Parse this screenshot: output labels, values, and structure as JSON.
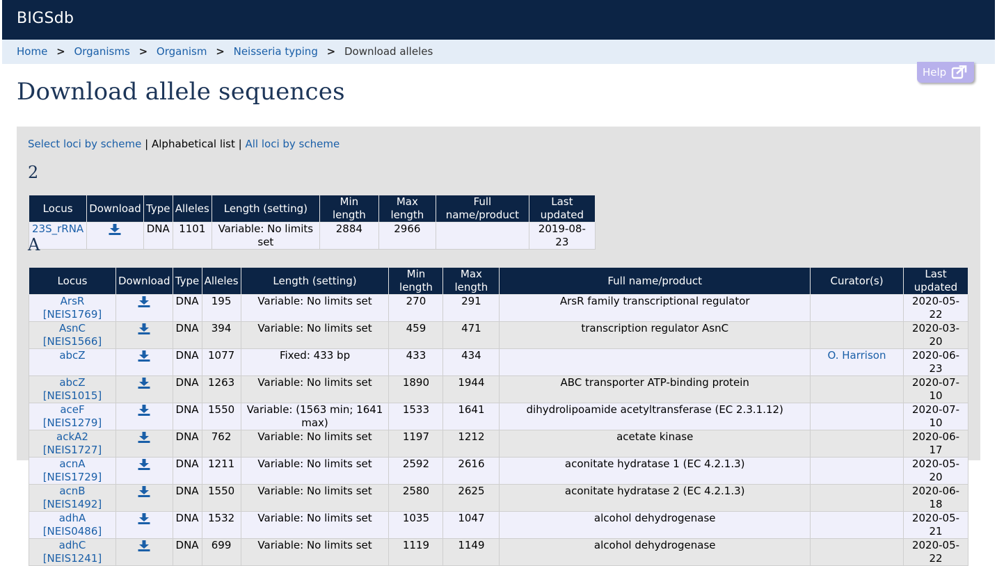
{
  "app": {
    "brand": "BIGSdb"
  },
  "breadcrumb": {
    "items": [
      {
        "label": "Home"
      },
      {
        "label": "Organisms"
      },
      {
        "label": "Organism"
      },
      {
        "label": "Neisseria typing"
      }
    ],
    "separator": ">",
    "current": "Download alleles"
  },
  "help": {
    "label": "Help",
    "icon": "external-link-icon"
  },
  "page": {
    "title": "Download allele sequences"
  },
  "tabs": {
    "select_by_scheme": "Select loci by scheme",
    "divider": "|",
    "alphabetical": "Alphabetical list",
    "all_by_scheme": "All loci by scheme"
  },
  "sections": [
    {
      "letter": "2",
      "headers": [
        "Locus",
        "Download",
        "Type",
        "Alleles",
        "Length (setting)",
        "Min length",
        "Max length",
        "Full name/product",
        "Last updated"
      ],
      "rows": [
        {
          "locus": "23S_rRNA",
          "type": "DNA",
          "alleles": "1101",
          "length": "Variable: No limits set",
          "min": "2884",
          "max": "2966",
          "product": "",
          "updated": "2019-08-23"
        }
      ]
    },
    {
      "letter": "A",
      "headers": [
        "Locus",
        "Download",
        "Type",
        "Alleles",
        "Length (setting)",
        "Min length",
        "Max length",
        "Full name/product",
        "Curator(s)",
        "Last updated"
      ],
      "rows": [
        {
          "locus": "ArsR [NEIS1769]",
          "type": "DNA",
          "alleles": "195",
          "length": "Variable: No limits set",
          "min": "270",
          "max": "291",
          "product": "ArsR family transcriptional regulator",
          "curator": "",
          "updated": "2020-05-22"
        },
        {
          "locus": "AsnC [NEIS1566]",
          "type": "DNA",
          "alleles": "394",
          "length": "Variable: No limits set",
          "min": "459",
          "max": "471",
          "product": "transcription regulator AsnC",
          "curator": "",
          "updated": "2020-03-20"
        },
        {
          "locus": "abcZ",
          "type": "DNA",
          "alleles": "1077",
          "length": "Fixed: 433 bp",
          "min": "433",
          "max": "434",
          "product": "",
          "curator": "O. Harrison",
          "updated": "2020-06-23"
        },
        {
          "locus": "abcZ [NEIS1015]",
          "type": "DNA",
          "alleles": "1263",
          "length": "Variable: No limits set",
          "min": "1890",
          "max": "1944",
          "product": "ABC transporter ATP-binding protein",
          "curator": "",
          "updated": "2020-07-10"
        },
        {
          "locus": "aceF [NEIS1279]",
          "type": "DNA",
          "alleles": "1550",
          "length": "Variable: (1563 min; 1641 max)",
          "min": "1533",
          "max": "1641",
          "product": "dihydrolipoamide acetyltransferase (EC 2.3.1.12)",
          "curator": "",
          "updated": "2020-07-10"
        },
        {
          "locus": "ackA2 [NEIS1727]",
          "type": "DNA",
          "alleles": "762",
          "length": "Variable: No limits set",
          "min": "1197",
          "max": "1212",
          "product": "acetate kinase",
          "curator": "",
          "updated": "2020-06-17"
        },
        {
          "locus": "acnA [NEIS1729]",
          "type": "DNA",
          "alleles": "1211",
          "length": "Variable: No limits set",
          "min": "2592",
          "max": "2616",
          "product": "aconitate hydratase 1 (EC 4.2.1.3)",
          "curator": "",
          "updated": "2020-05-20"
        },
        {
          "locus": "acnB [NEIS1492]",
          "type": "DNA",
          "alleles": "1550",
          "length": "Variable: No limits set",
          "min": "2580",
          "max": "2625",
          "product": "aconitate hydratase 2 (EC 4.2.1.3)",
          "curator": "",
          "updated": "2020-06-18"
        },
        {
          "locus": "adhA [NEIS0486]",
          "type": "DNA",
          "alleles": "1532",
          "length": "Variable: No limits set",
          "min": "1035",
          "max": "1047",
          "product": "alcohol dehydrogenase",
          "curator": "",
          "updated": "2020-05-21"
        },
        {
          "locus": "adhC [NEIS1241]",
          "type": "DNA",
          "alleles": "699",
          "length": "Variable: No limits set",
          "min": "1119",
          "max": "1149",
          "product": "alcohol dehydrogenase",
          "curator": "",
          "updated": "2020-05-22"
        }
      ]
    }
  ],
  "colors": {
    "header_bg": "#0c2445",
    "link": "#1a5fa8",
    "panel_bg": "#e2e2e2",
    "help_bg": "#b8b1ec"
  },
  "icons": {
    "download": "download-icon"
  }
}
